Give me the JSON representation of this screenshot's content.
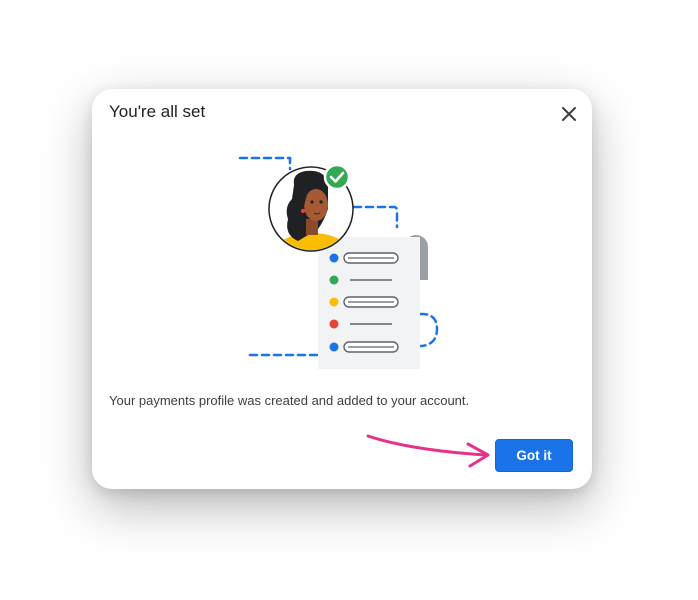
{
  "dialog": {
    "title": "You're all set",
    "message": "Your payments profile was created and added to your account.",
    "primary_button_label": "Got it",
    "close_icon": "close-icon"
  },
  "illustration": {
    "subject": "avatar-with-receipt",
    "list_dot_colors": [
      "#1a73e8",
      "#34a853",
      "#fbbc04",
      "#ea4335",
      "#1a73e8"
    ],
    "accent_color": "#1a73e8",
    "check_color": "#34a853"
  },
  "annotation": {
    "arrow_icon": "pointing-arrow-icon",
    "arrow_color": "#e8318a"
  },
  "colors": {
    "primary": "#1a73e8",
    "title_text": "#202124",
    "body_text": "#3c4043"
  }
}
